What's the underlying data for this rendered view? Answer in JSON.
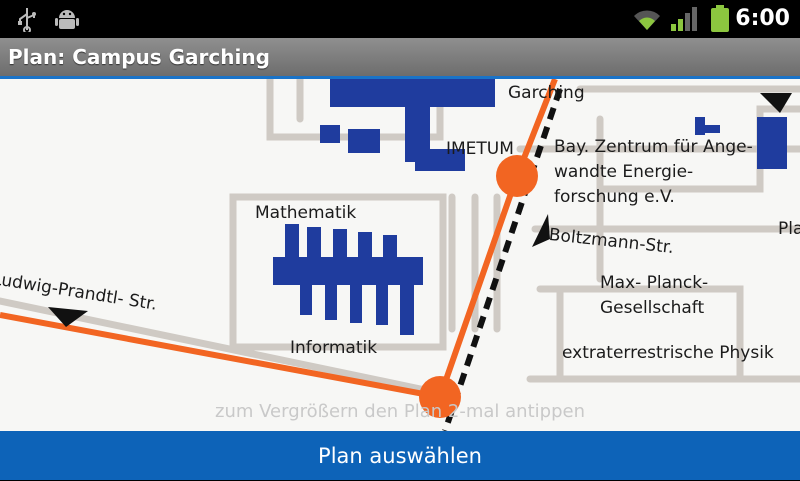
{
  "status_bar": {
    "time": "6:00",
    "icons": [
      "usb-icon",
      "android-debug-icon",
      "wifi-icon",
      "signal-icon",
      "battery-icon"
    ]
  },
  "title_bar": {
    "title": "Plan: Campus Garching"
  },
  "map": {
    "labels": {
      "garching": "Garching",
      "imetum": "IMETUM",
      "bay_zentrum": "Bay. Zentrum für Ange-\nwandte Energie-\nforschung e.V.",
      "mathematik": "Mathematik",
      "ludwig": "Ludwig-Prandtl- Str.",
      "boltzmann": "Boltzmann-Str.",
      "max_planck": "Max- Planck-\nGesellschaft",
      "informatik": "Informatik",
      "extra": "extraterrestrische Physik",
      "pla": "Pla"
    },
    "hint": "zum Vergrößern den Plan 2-mal antippen"
  },
  "bottom_button": {
    "label": "Plan auswählen"
  },
  "colors": {
    "accent": "#0d63b8",
    "route": "#f26522",
    "building": "#1f3c9e"
  }
}
